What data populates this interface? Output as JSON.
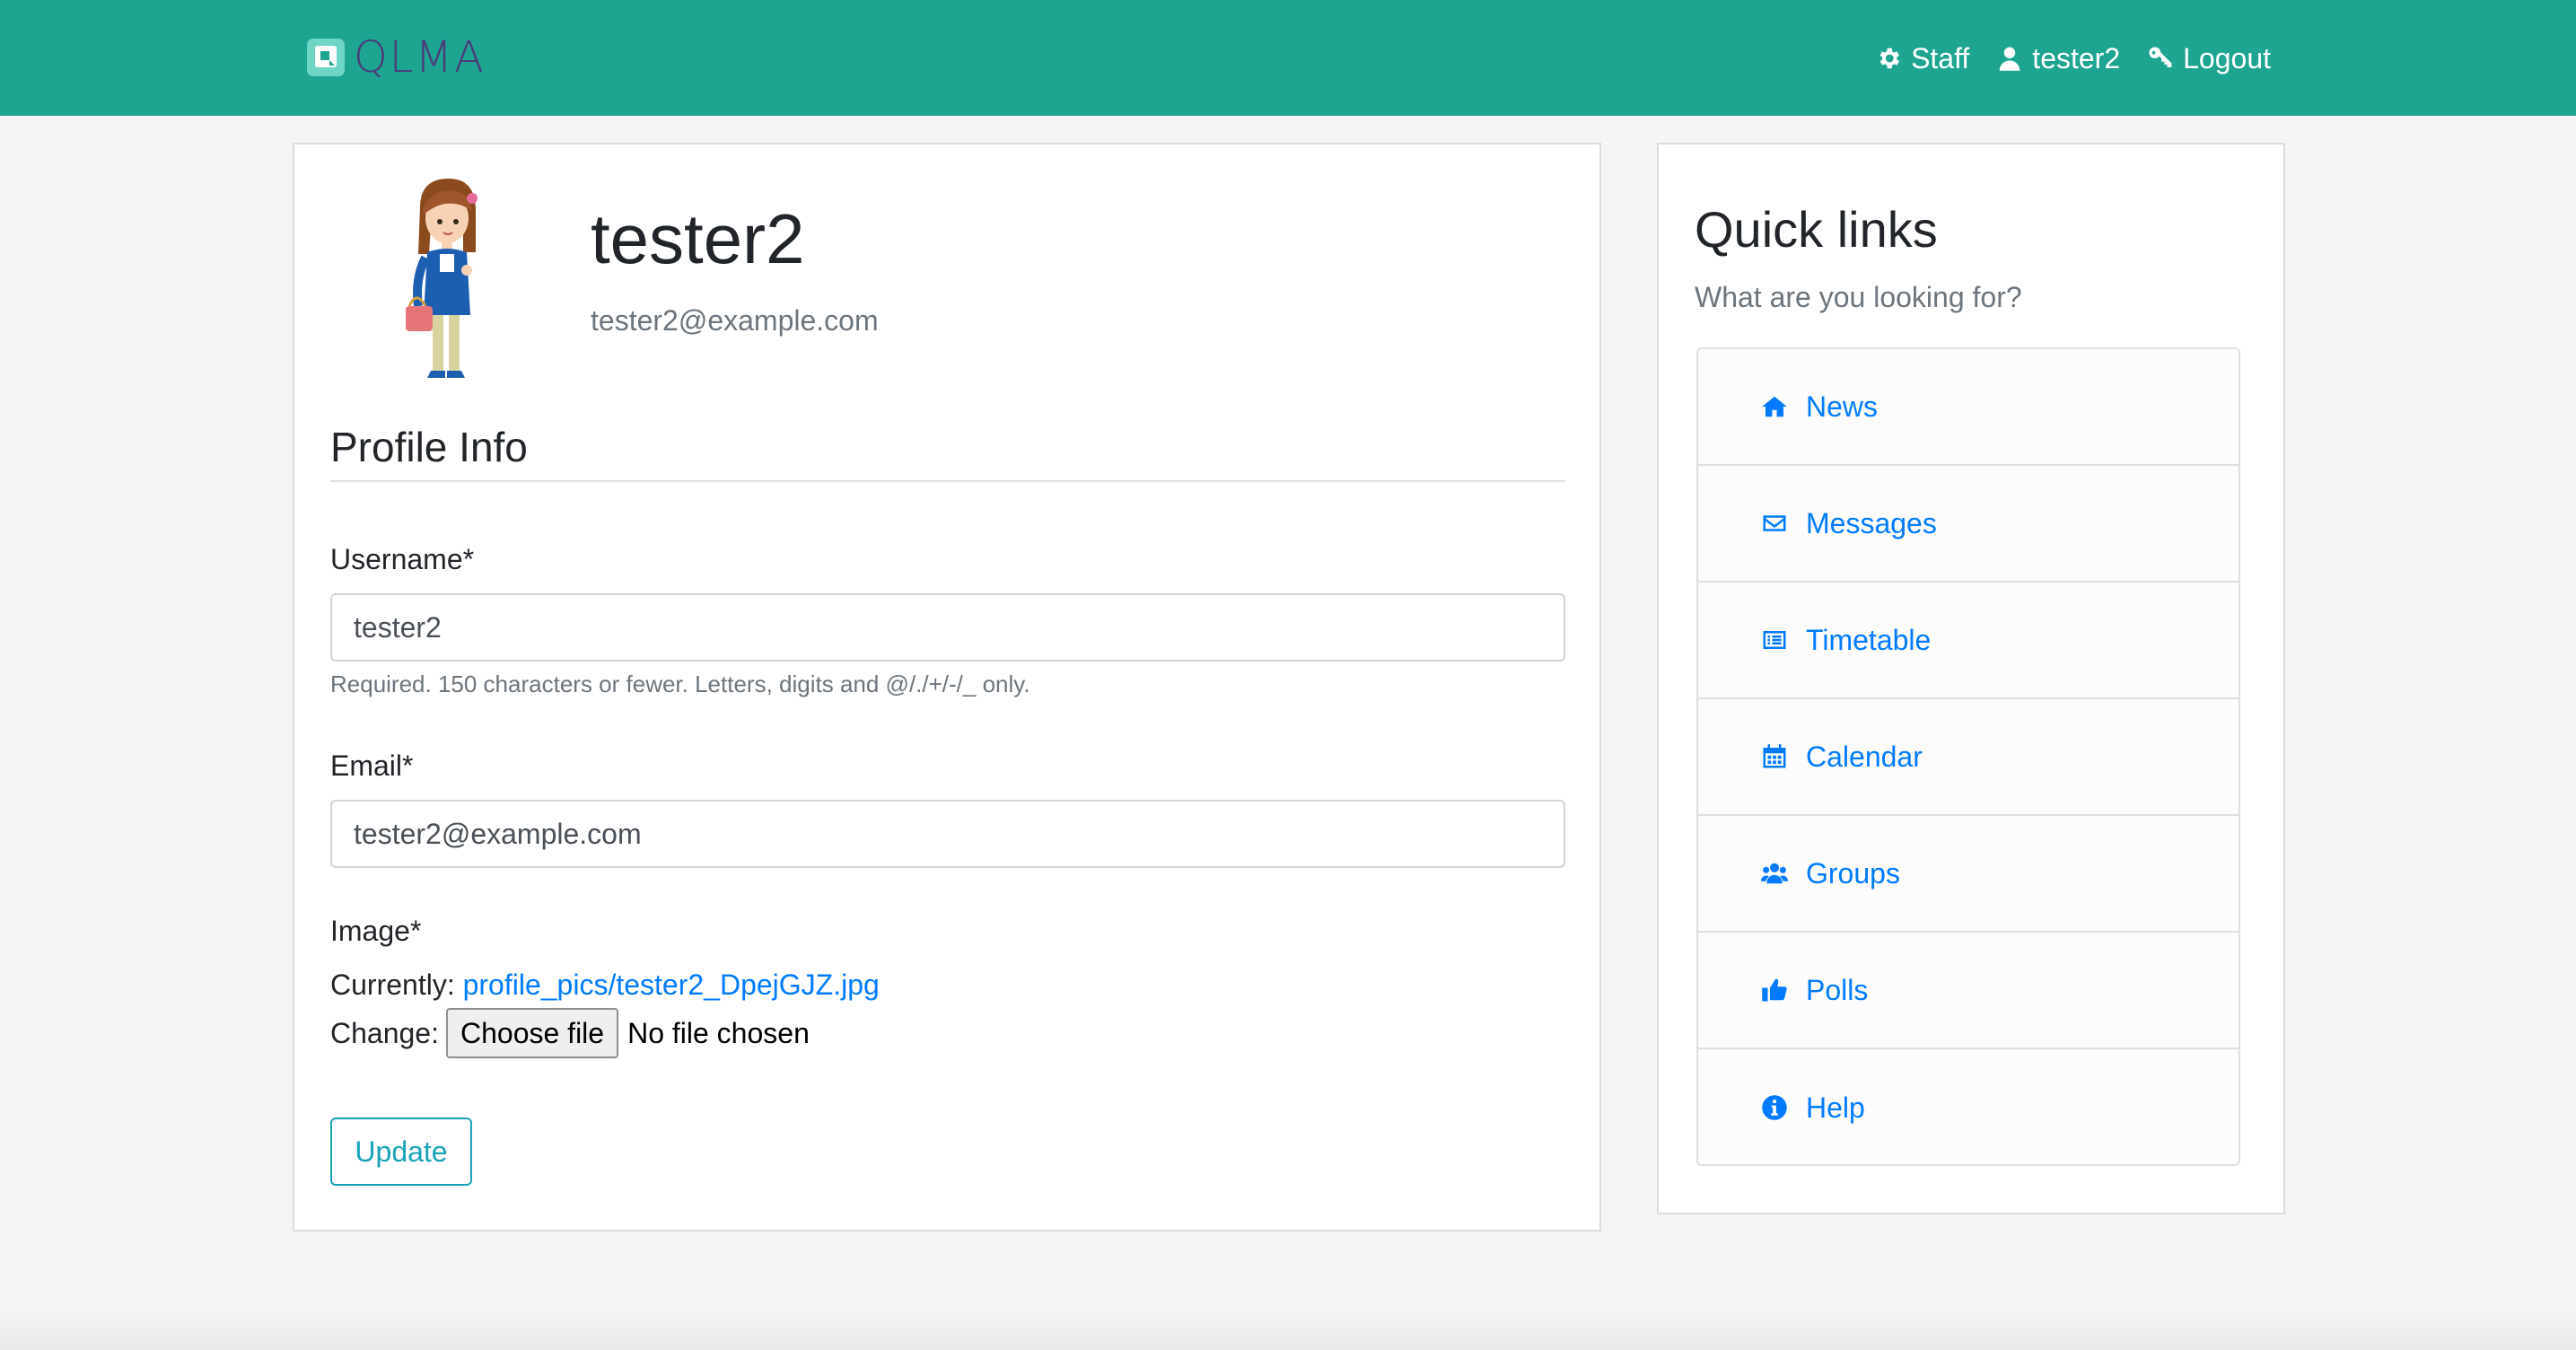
{
  "brand": {
    "name": "QLMA"
  },
  "nav": {
    "staff_label": "Staff",
    "user_label": "tester2",
    "logout_label": "Logout"
  },
  "profile": {
    "name": "tester2",
    "email": "tester2@example.com",
    "section_title": "Profile Info"
  },
  "form": {
    "username_label": "Username*",
    "username_value": "tester2",
    "username_help": "Required. 150 characters or fewer. Letters, digits and @/./+/-/_ only.",
    "email_label": "Email*",
    "email_value": "tester2@example.com",
    "image_label": "Image*",
    "currently_label": "Currently:",
    "currently_link": "profile_pics/tester2_DpejGJZ.jpg",
    "change_label": "Change:",
    "choose_file_label": "Choose file",
    "no_file_label": "No file chosen",
    "update_label": "Update"
  },
  "quick_links": {
    "title": "Quick links",
    "subtitle": "What are you looking for?",
    "items": [
      {
        "label": "News",
        "icon": "home-icon"
      },
      {
        "label": "Messages",
        "icon": "envelope-icon"
      },
      {
        "label": "Timetable",
        "icon": "list-alt-icon"
      },
      {
        "label": "Calendar",
        "icon": "calendar-icon"
      },
      {
        "label": "Groups",
        "icon": "users-icon"
      },
      {
        "label": "Polls",
        "icon": "thumbs-up-icon"
      },
      {
        "label": "Help",
        "icon": "info-circle-icon"
      }
    ]
  },
  "colors": {
    "navbar": "#1ea591",
    "link": "#007bff",
    "update_button": "#17a2b8"
  }
}
